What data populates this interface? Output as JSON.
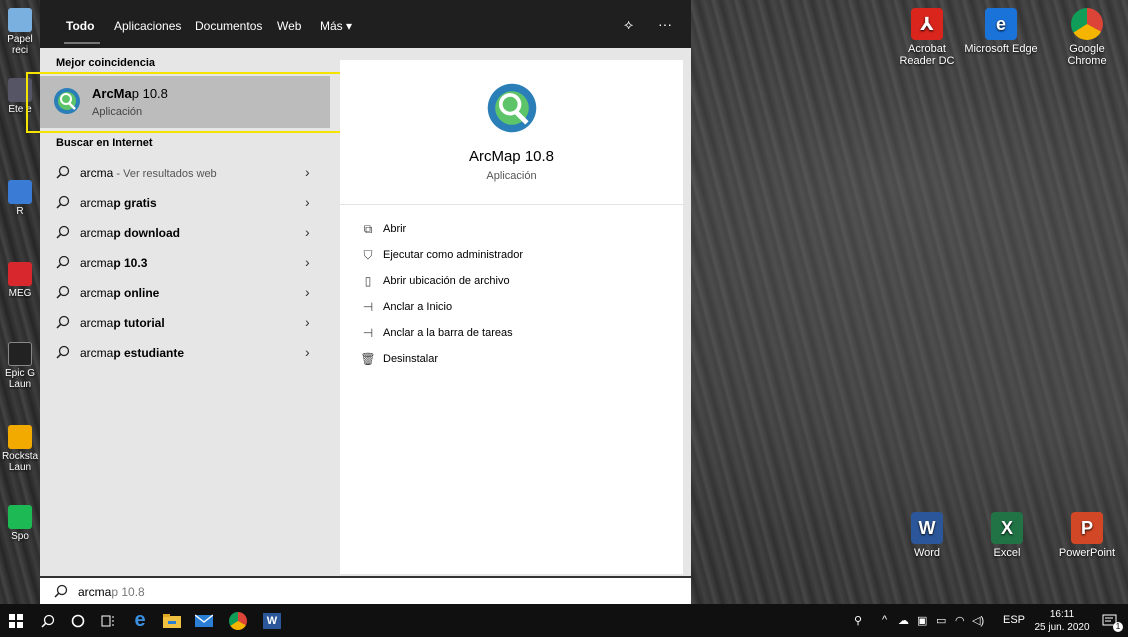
{
  "desktop": {
    "icons_right": [
      {
        "label": "Acrobat Reader DC",
        "icon": "acrobat-icon",
        "color": "#d9251c"
      },
      {
        "label": "Microsoft Edge",
        "icon": "edge-icon",
        "color": "#1a73d9"
      },
      {
        "label": "Google Chrome",
        "icon": "chrome-icon",
        "color": "#e8a11b"
      },
      {
        "label": "Word",
        "icon": "word-icon",
        "color": "#2b579a"
      },
      {
        "label": "Excel",
        "icon": "excel-icon",
        "color": "#217346"
      },
      {
        "label": "PowerPoint",
        "icon": "powerpoint-icon",
        "color": "#d24726"
      }
    ],
    "icons_left_partial": [
      "Papel reci",
      "Ete e",
      "R",
      "MEG",
      "Epic G Laun",
      "Rocksta Laun",
      "Spo"
    ]
  },
  "search": {
    "tabs": [
      {
        "label": "Todo",
        "active": true
      },
      {
        "label": "Aplicaciones",
        "active": false
      },
      {
        "label": "Documentos",
        "active": false
      },
      {
        "label": "Web",
        "active": false
      },
      {
        "label": "Más ▾",
        "active": false
      }
    ],
    "feedback_icon": "⟡",
    "more_icon": "···",
    "best_match_header": "Mejor coincidencia",
    "best_match": {
      "name_bold": "ArcMa",
      "name_rest": "p 10.8",
      "type": "Aplicación"
    },
    "web_header": "Buscar en Internet",
    "web_results": [
      {
        "prefix": "arcma",
        "bold": "",
        "suffix": " - Ver resultados web"
      },
      {
        "prefix": "arcma",
        "bold": "p gratis",
        "suffix": ""
      },
      {
        "prefix": "arcma",
        "bold": "p download",
        "suffix": ""
      },
      {
        "prefix": "arcma",
        "bold": "p 10.3",
        "suffix": ""
      },
      {
        "prefix": "arcma",
        "bold": "p online",
        "suffix": ""
      },
      {
        "prefix": "arcma",
        "bold": "p tutorial",
        "suffix": ""
      },
      {
        "prefix": "arcma",
        "bold": "p estudiante",
        "suffix": ""
      }
    ],
    "detail": {
      "name": "ArcMap 10.8",
      "type": "Aplicación",
      "actions": [
        {
          "label": "Abrir",
          "icon": "open-icon",
          "glyph": "⧉"
        },
        {
          "label": "Ejecutar como administrador",
          "icon": "shield-run-icon",
          "glyph": "⛉"
        },
        {
          "label": "Abrir ubicación de archivo",
          "icon": "file-location-icon",
          "glyph": "▯"
        },
        {
          "label": "Anclar a Inicio",
          "icon": "pin-icon",
          "glyph": "⊣"
        },
        {
          "label": "Anclar a la barra de tareas",
          "icon": "pin-taskbar-icon",
          "glyph": "⊣"
        },
        {
          "label": "Desinstalar",
          "icon": "trash-icon",
          "glyph": "🗑"
        }
      ]
    },
    "query_typed": "arcma",
    "query_autocomplete": "p 10.8"
  },
  "taskbar": {
    "tray_lang": "ESP",
    "clock_time": "16:11",
    "clock_date": "25 jun. 2020",
    "notification_count": "1"
  }
}
